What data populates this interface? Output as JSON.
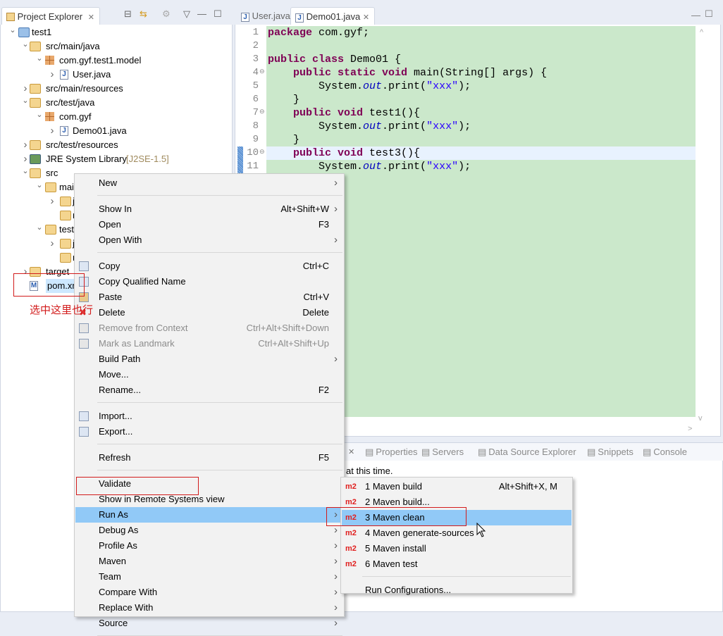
{
  "explorer": {
    "tab_label": "Project Explorer",
    "tree": [
      {
        "label": "test1",
        "level": 0,
        "chev": "v",
        "icon": "maven-project-icon"
      },
      {
        "label": "src/main/java",
        "level": 1,
        "chev": "v",
        "icon": "source-folder-icon"
      },
      {
        "label": "com.gyf.test1.model",
        "level": 2,
        "chev": "v",
        "icon": "package-icon"
      },
      {
        "label": "User.java",
        "level": 3,
        "chev": ">",
        "icon": "java-file-icon"
      },
      {
        "label": "src/main/resources",
        "level": 1,
        "chev": ">",
        "icon": "source-folder-icon"
      },
      {
        "label": "src/test/java",
        "level": 1,
        "chev": "v",
        "icon": "source-folder-icon"
      },
      {
        "label": "com.gyf",
        "level": 2,
        "chev": "v",
        "icon": "package-icon"
      },
      {
        "label": "Demo01.java",
        "level": 3,
        "chev": ">",
        "icon": "java-file-icon"
      },
      {
        "label": "src/test/resources",
        "level": 1,
        "chev": ">",
        "icon": "source-folder-icon"
      },
      {
        "label": "JRE System Library",
        "suffix": "[J2SE-1.5]",
        "level": 1,
        "chev": ">",
        "icon": "library-icon"
      },
      {
        "label": "src",
        "level": 1,
        "chev": "v",
        "icon": "folder-icon"
      },
      {
        "label": "main",
        "level": 2,
        "chev": "v",
        "icon": "folder-icon"
      },
      {
        "label": "java",
        "level": 3,
        "chev": ">",
        "icon": "folder-icon"
      },
      {
        "label": "resources",
        "level": 3,
        "chev": "",
        "icon": "folder-icon"
      },
      {
        "label": "test",
        "level": 2,
        "chev": "v",
        "icon": "folder-icon"
      },
      {
        "label": "java",
        "level": 3,
        "chev": ">",
        "icon": "folder-icon"
      },
      {
        "label": "resources",
        "level": 3,
        "chev": "",
        "icon": "folder-icon"
      },
      {
        "label": "target",
        "level": 1,
        "chev": ">",
        "icon": "folder-icon"
      },
      {
        "label": "pom.xml",
        "level": 1,
        "chev": "",
        "icon": "pom-file-icon",
        "selected": true
      }
    ]
  },
  "annotation": {
    "text": "选中这里也行",
    "color": "#d21b1b"
  },
  "editor": {
    "tabs": [
      "User.java",
      "Demo01.java"
    ],
    "active_tab": 1,
    "lines": [
      "<k>package</k> com.gyf;",
      "",
      "<k>public class</k> Demo01 {",
      "    <k>public static void</k> main(String[] args) {",
      "        System.<f>out</f>.print(<s>\"xxx\"</s>);",
      "    }",
      "    <k>public void</k> test1(){",
      "        System.<f>out</f>.print(<s>\"xxx\"</s>);",
      "    }",
      "    <k>public void</k> test3(){",
      "        System.<f>out</f>.print(<s>\"xxx\"</s>);"
    ],
    "current_line": 10,
    "background": "#cbe8cb"
  },
  "bottom": {
    "tabs": [
      "Properties",
      "Servers",
      "Data Source Explorer",
      "Snippets",
      "Console"
    ],
    "message": "at this time."
  },
  "context_menu": {
    "items": [
      {
        "label": "New",
        "arrow": true
      },
      {
        "sep": true
      },
      {
        "label": "Show In",
        "shortcut": "Alt+Shift+W",
        "arrow": true
      },
      {
        "label": "Open",
        "shortcut": "F3"
      },
      {
        "label": "Open With",
        "arrow": true
      },
      {
        "sep": true
      },
      {
        "label": "Copy",
        "shortcut": "Ctrl+C",
        "icon": "copy-icon"
      },
      {
        "label": "Copy Qualified Name",
        "icon": "copy-qualified-icon"
      },
      {
        "label": "Paste",
        "shortcut": "Ctrl+V",
        "icon": "paste-icon"
      },
      {
        "label": "Delete",
        "shortcut": "Delete",
        "icon": "delete-icon"
      },
      {
        "label": "Remove from Context",
        "shortcut": "Ctrl+Alt+Shift+Down",
        "disabled": true,
        "icon": "remove-context-icon"
      },
      {
        "label": "Mark as Landmark",
        "shortcut": "Ctrl+Alt+Shift+Up",
        "disabled": true,
        "icon": "landmark-icon"
      },
      {
        "label": "Build Path",
        "arrow": true
      },
      {
        "label": "Move..."
      },
      {
        "label": "Rename...",
        "shortcut": "F2"
      },
      {
        "sep": true
      },
      {
        "label": "Import...",
        "icon": "import-icon"
      },
      {
        "label": "Export...",
        "icon": "export-icon"
      },
      {
        "sep": true
      },
      {
        "label": "Refresh",
        "shortcut": "F5"
      },
      {
        "sep": true
      },
      {
        "label": "Validate"
      },
      {
        "label": "Show in Remote Systems view"
      },
      {
        "label": "Run As",
        "arrow": true,
        "highlighted": true
      },
      {
        "label": "Debug As",
        "arrow": true
      },
      {
        "label": "Profile As",
        "arrow": true
      },
      {
        "label": "Maven",
        "arrow": true
      },
      {
        "label": "Team",
        "arrow": true
      },
      {
        "label": "Compare With",
        "arrow": true
      },
      {
        "label": "Replace With",
        "arrow": true
      },
      {
        "label": "Source",
        "arrow": true
      },
      {
        "sep": true
      }
    ]
  },
  "run_as_menu": {
    "items": [
      {
        "label": "1 Maven build",
        "shortcut": "Alt+Shift+X, M",
        "badge": "m2"
      },
      {
        "label": "2 Maven build...",
        "badge": "m2"
      },
      {
        "label": "3 Maven clean",
        "badge": "m2",
        "highlighted": true
      },
      {
        "label": "4 Maven generate-sources",
        "badge": "m2"
      },
      {
        "label": "5 Maven install",
        "badge": "m2"
      },
      {
        "label": "6 Maven test",
        "badge": "m2"
      },
      {
        "sep": true
      },
      {
        "label": "Run Configurations..."
      }
    ]
  },
  "colors": {
    "highlight": "#91c9f7",
    "annotation_box": "#d21b1b"
  }
}
